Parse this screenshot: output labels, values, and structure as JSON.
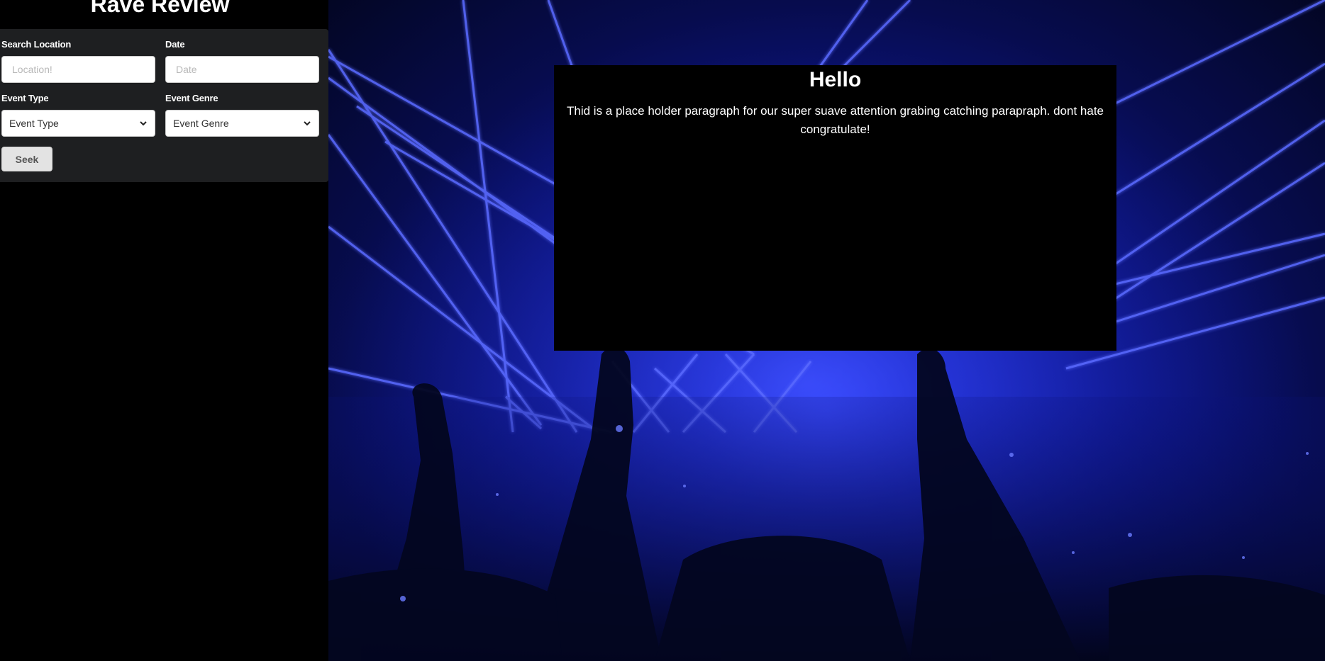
{
  "app": {
    "title": "Rave Review"
  },
  "search": {
    "location_label": "Search Location",
    "location_placeholder": "Location!",
    "date_label": "Date",
    "date_placeholder": "Date",
    "event_type_label": "Event Type",
    "event_type_selected": "Event Type",
    "event_genre_label": "Event Genre",
    "event_genre_selected": "Event Genre",
    "seek_label": "Seek"
  },
  "hero": {
    "heading": "Hello",
    "paragraph": "Thid is a place holder paragraph for our super suave attention grabing catching parapraph. dont hate congratulate!"
  },
  "colors": {
    "sidebar_bg": "#000000",
    "panel_bg": "#1e1f21",
    "laser_blue": "#3d4dff",
    "card_bg": "#000000"
  },
  "icons": {
    "select_arrow": "chevron-down-icon"
  }
}
